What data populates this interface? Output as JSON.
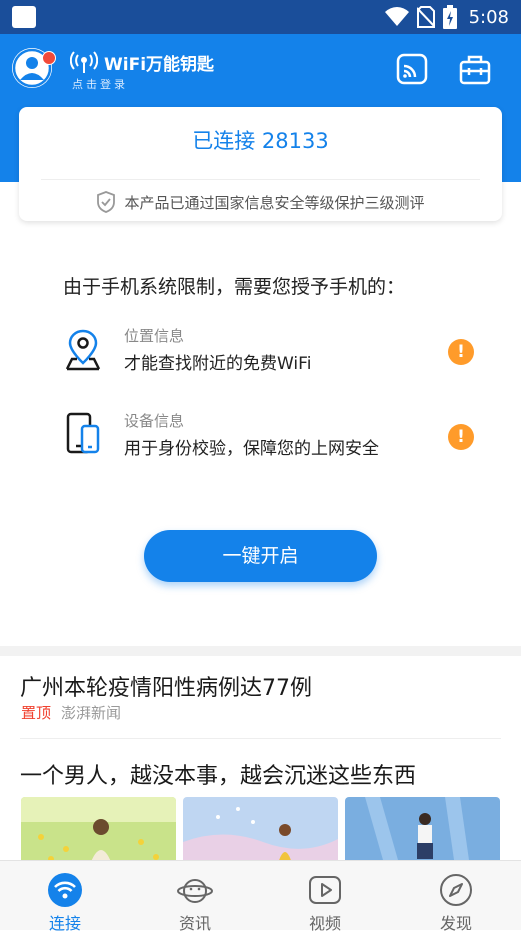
{
  "status_bar": {
    "time": "5:08"
  },
  "header": {
    "app_name": "WiFi万能钥匙",
    "login_text": "点击登录"
  },
  "card": {
    "connection_status": "已连接 28133",
    "security_notice": "本产品已通过国家信息安全等级保护三级测评"
  },
  "permissions": {
    "title": "由于手机系统限制，需要您授予手机的：",
    "items": [
      {
        "label": "位置信息",
        "desc": "才能查找附近的免费WiFi",
        "icon": "location-pin-icon",
        "warn": "!"
      },
      {
        "label": "设备信息",
        "desc": "用于身份校验，保障您的上网安全",
        "icon": "phone-device-icon",
        "warn": "!"
      }
    ]
  },
  "cta": {
    "label": "一键开启"
  },
  "news": {
    "items": [
      {
        "title": "广州本轮疫情阳性病例达77例",
        "tag": "置顶",
        "source": "澎湃新闻"
      },
      {
        "title": "一个男人，越没本事，越会沉迷这些东西"
      }
    ]
  },
  "tabs": [
    {
      "label": "连接",
      "icon": "wifi-icon",
      "active": true
    },
    {
      "label": "资讯",
      "icon": "planet-icon",
      "active": false
    },
    {
      "label": "视频",
      "icon": "play-icon",
      "active": false
    },
    {
      "label": "发现",
      "icon": "compass-icon",
      "active": false
    }
  ],
  "colors": {
    "primary": "#1482ea",
    "status_bar": "#1a4e9a",
    "warning": "#ff9b2a",
    "pin": "#f0412f"
  }
}
